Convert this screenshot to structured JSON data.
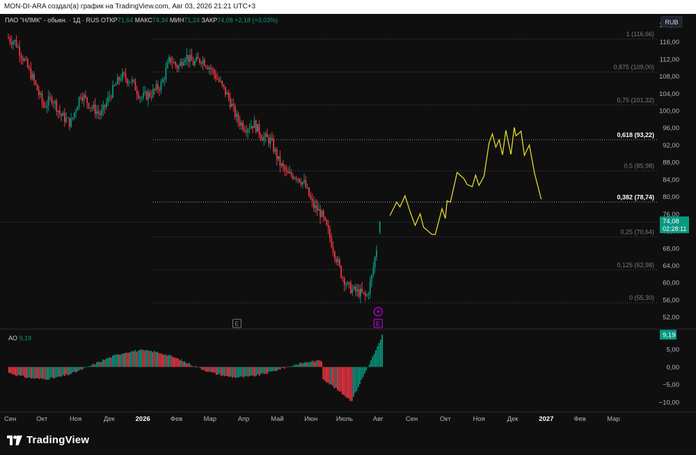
{
  "header": {
    "caption": "MON-DI-ARA создал(а) график на TradingView.com, Авг 03, 2026 21:21 UTC+3"
  },
  "legend": {
    "symbol": "ПАО \"НЛМК\" - обыкн. · 1Д · RUS",
    "open_label": "ОТКР",
    "open": "71,64",
    "high_label": "МАКС",
    "high": "74,34",
    "low_label": "МИН",
    "low": "71,24",
    "close_label": "ЗАКР",
    "close": "74,08",
    "change": "+2,18 (+3,03%)"
  },
  "currency": "RUB",
  "price_tag": {
    "value": "74,08",
    "countdown": "02:28:11",
    "color": "#089981"
  },
  "ao": {
    "label": "AO",
    "value": "9,19",
    "tag": "9,19"
  },
  "brand": {
    "name": "TradingView"
  },
  "colors": {
    "background": "#0f0f0f",
    "up": "#089981",
    "down": "#f23645",
    "forecast": "#e6d82c",
    "fib_label": "#787b86",
    "event": "#d500f9"
  },
  "chart_data": {
    "type": "candlestick",
    "price_axis": {
      "min": 50,
      "max": 122,
      "ticks": [
        120,
        116,
        112,
        108,
        104,
        100,
        96,
        92,
        88,
        84,
        80,
        76,
        72,
        68,
        64,
        60,
        56,
        52
      ],
      "tick_labels": [
        "120,00",
        "116,00",
        "112,00",
        "108,00",
        "104,00",
        "100,00",
        "96,00",
        "92,00",
        "88,00",
        "84,00",
        "80,00",
        "76,00",
        "72,00",
        "68,00",
        "64,00",
        "60,00",
        "56,00",
        "52,00"
      ]
    },
    "time_axis": {
      "labels": [
        "Сен",
        "Окт",
        "Ноя",
        "Дек",
        "2026",
        "Фев",
        "Мар",
        "Апр",
        "Май",
        "Июн",
        "Июль",
        "Авг",
        "Сен",
        "Окт",
        "Ноя",
        "Дек",
        "2027",
        "Фев",
        "Мар"
      ],
      "bold": [
        "2026",
        "2027"
      ]
    },
    "fibonacci": [
      {
        "level": "1",
        "price": 116.66,
        "label": "1 (116,66)"
      },
      {
        "level": "0.875",
        "price": 109.0,
        "label": "0,875 (109,00)"
      },
      {
        "level": "0.75",
        "price": 101.32,
        "label": "0,75 (101,32)"
      },
      {
        "level": "0.618",
        "price": 93.22,
        "label": "0,618 (93,22)",
        "highlight": true
      },
      {
        "level": "0.5",
        "price": 85.98,
        "label": "0,5 (85,98)"
      },
      {
        "level": "0.382",
        "price": 78.74,
        "label": "0,382 (78,74)",
        "highlight": true
      },
      {
        "level": "0.25",
        "price": 70.64,
        "label": "0,25 (70,64)"
      },
      {
        "level": "0.125",
        "price": 62.98,
        "label": "0,125 (62,98)"
      },
      {
        "level": "0",
        "price": 55.3,
        "label": "0 (55,30)"
      }
    ],
    "trend_path": [
      {
        "m": 0,
        "p": 117
      },
      {
        "m": 0.25,
        "p": 116
      },
      {
        "m": 0.5,
        "p": 112
      },
      {
        "m": 0.8,
        "p": 107
      },
      {
        "m": 1.1,
        "p": 101
      },
      {
        "m": 1.35,
        "p": 103
      },
      {
        "m": 1.6,
        "p": 99
      },
      {
        "m": 1.9,
        "p": 97
      },
      {
        "m": 2.2,
        "p": 104
      },
      {
        "m": 2.5,
        "p": 101
      },
      {
        "m": 2.8,
        "p": 99
      },
      {
        "m": 3.1,
        "p": 104
      },
      {
        "m": 3.4,
        "p": 108
      },
      {
        "m": 3.7,
        "p": 107
      },
      {
        "m": 4.0,
        "p": 103
      },
      {
        "m": 4.3,
        "p": 104
      },
      {
        "m": 4.6,
        "p": 106
      },
      {
        "m": 4.85,
        "p": 112
      },
      {
        "m": 5.1,
        "p": 110
      },
      {
        "m": 5.3,
        "p": 113
      },
      {
        "m": 5.55,
        "p": 111
      },
      {
        "m": 5.8,
        "p": 112
      },
      {
        "m": 6.05,
        "p": 110
      },
      {
        "m": 6.3,
        "p": 107
      },
      {
        "m": 6.6,
        "p": 103
      },
      {
        "m": 6.85,
        "p": 98
      },
      {
        "m": 7.1,
        "p": 96
      },
      {
        "m": 7.35,
        "p": 97
      },
      {
        "m": 7.6,
        "p": 94
      },
      {
        "m": 7.85,
        "p": 93
      },
      {
        "m": 8.1,
        "p": 88
      },
      {
        "m": 8.35,
        "p": 85
      },
      {
        "m": 8.6,
        "p": 85
      },
      {
        "m": 8.85,
        "p": 83
      },
      {
        "m": 9.1,
        "p": 78
      },
      {
        "m": 9.35,
        "p": 76
      },
      {
        "m": 9.55,
        "p": 72
      },
      {
        "m": 9.75,
        "p": 67
      },
      {
        "m": 9.95,
        "p": 62
      },
      {
        "m": 10.15,
        "p": 59
      },
      {
        "m": 10.35,
        "p": 58
      },
      {
        "m": 10.55,
        "p": 57.5
      },
      {
        "m": 10.7,
        "p": 56.5
      },
      {
        "m": 10.85,
        "p": 61
      },
      {
        "m": 11.0,
        "p": 68
      },
      {
        "m": 11.05,
        "p": 74
      }
    ],
    "ohlc_last": {
      "open": 71.64,
      "high": 74.34,
      "low": 71.24,
      "close": 74.08
    },
    "forecast_path": [
      {
        "m": 11.35,
        "p": 75.6
      },
      {
        "m": 11.55,
        "p": 78.7
      },
      {
        "m": 11.65,
        "p": 77.6
      },
      {
        "m": 11.8,
        "p": 80.2
      },
      {
        "m": 11.95,
        "p": 76.5
      },
      {
        "m": 12.1,
        "p": 73.3
      },
      {
        "m": 12.25,
        "p": 76.0
      },
      {
        "m": 12.35,
        "p": 72.9
      },
      {
        "m": 12.6,
        "p": 71.2
      },
      {
        "m": 12.7,
        "p": 71.2
      },
      {
        "m": 12.9,
        "p": 77.2
      },
      {
        "m": 13.0,
        "p": 74.9
      },
      {
        "m": 13.05,
        "p": 79.0
      },
      {
        "m": 13.15,
        "p": 78.7
      },
      {
        "m": 13.35,
        "p": 85.6
      },
      {
        "m": 13.55,
        "p": 84.2
      },
      {
        "m": 13.65,
        "p": 82.8
      },
      {
        "m": 13.8,
        "p": 82.3
      },
      {
        "m": 13.9,
        "p": 85.0
      },
      {
        "m": 14.0,
        "p": 82.6
      },
      {
        "m": 14.15,
        "p": 84.7
      },
      {
        "m": 14.3,
        "p": 92.5
      },
      {
        "m": 14.4,
        "p": 94.6
      },
      {
        "m": 14.5,
        "p": 91.5
      },
      {
        "m": 14.6,
        "p": 93.2
      },
      {
        "m": 14.7,
        "p": 89.7
      },
      {
        "m": 14.8,
        "p": 95.4
      },
      {
        "m": 14.95,
        "p": 89.8
      },
      {
        "m": 15.05,
        "p": 96.1
      },
      {
        "m": 15.1,
        "p": 94.1
      },
      {
        "m": 15.25,
        "p": 95.2
      },
      {
        "m": 15.35,
        "p": 89.6
      },
      {
        "m": 15.5,
        "p": 92.0
      },
      {
        "m": 15.65,
        "p": 85.5
      },
      {
        "m": 15.85,
        "p": 79.4
      }
    ],
    "indicator": {
      "name": "AO",
      "ticks": [
        5,
        0,
        -5,
        -10
      ],
      "tick_labels": [
        "5,00",
        "0,00",
        "−5,00",
        "−10,00"
      ],
      "range": [
        -13,
        10
      ],
      "last": 9.19
    },
    "events": [
      {
        "label": "E",
        "at_month": 6.8,
        "color": "#787b86"
      },
      {
        "label": "E",
        "at_month": 11.0,
        "color": "#d500f9"
      }
    ],
    "grid": false
  }
}
